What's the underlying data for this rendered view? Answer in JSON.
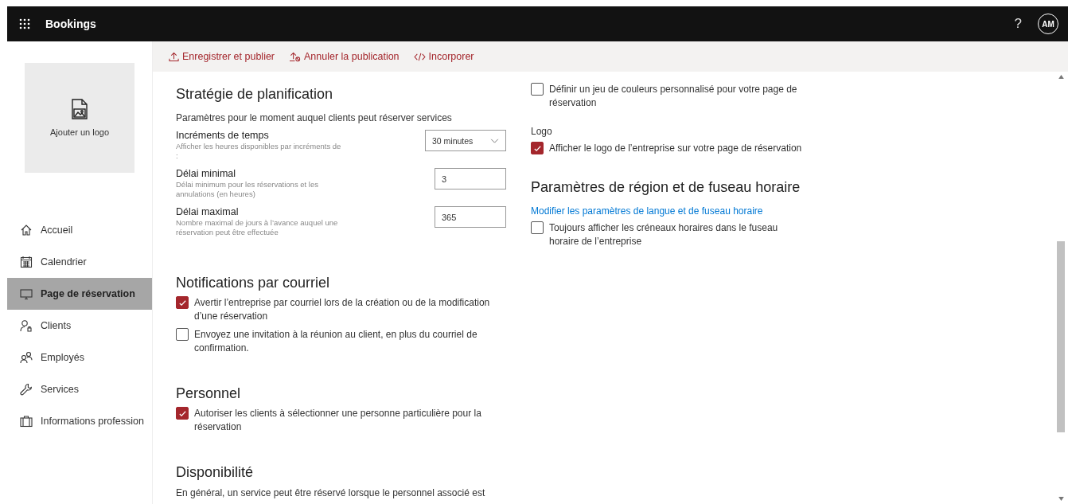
{
  "topbar": {
    "app_title": "Bookings",
    "help": "?",
    "avatar": "AM"
  },
  "toolbar": [
    {
      "label": "Enregistrer et publier"
    },
    {
      "label": "Annuler la publication"
    },
    {
      "label": "Incorporer"
    }
  ],
  "sidebar": {
    "logo_label": "Ajouter un logo",
    "items": [
      {
        "label": "Accueil",
        "selected": false
      },
      {
        "label": "Calendrier",
        "selected": false
      },
      {
        "label": "Page de réservation",
        "selected": true
      },
      {
        "label": "Clients",
        "selected": false
      },
      {
        "label": "Employés",
        "selected": false
      },
      {
        "label": "Services",
        "selected": false
      },
      {
        "label": "Informations profession",
        "selected": false
      }
    ]
  },
  "planning": {
    "title": "Stratégie de planification",
    "subtitle": "Paramètres pour le moment auquel clients peut réserver services",
    "settings": [
      {
        "kind": "select",
        "label": "Incréments de temps",
        "hint": "Afficher les heures disponibles par incréments de :",
        "value": "30 minutes"
      },
      {
        "kind": "text",
        "label": "Délai minimal",
        "hint": "Délai minimum pour les réservations et les annulations (en heures)",
        "value": "3"
      },
      {
        "kind": "text",
        "label": "Délai maximal",
        "hint": "Nombre maximal de jours à l’avance auquel une réservation peut être effectuée",
        "value": "365"
      }
    ]
  },
  "notifications": {
    "title": "Notifications par courriel",
    "options": [
      {
        "label": "Avertir l’entreprise par courriel lors de la création ou de la modification d’une réservation",
        "checked": true
      },
      {
        "label": "Envoyez une invitation à la réunion au client, en plus du courriel de confirmation.",
        "checked": false
      }
    ]
  },
  "personnel": {
    "title": "Personnel",
    "options": [
      {
        "label": "Autoriser les clients à sélectionner une personne particulière pour la réservation",
        "checked": true
      }
    ]
  },
  "availability": {
    "title": "Disponibilité",
    "text": "En général, un service peut être réservé lorsque le personnel associé est"
  },
  "colors": {
    "options": [
      {
        "label": "Définir un jeu de couleurs personnalisé pour votre page de réservation",
        "checked": false
      }
    ]
  },
  "logo": {
    "label": "Logo",
    "options": [
      {
        "label": "Afficher le logo de l’entreprise sur votre page de réservation",
        "checked": true
      }
    ]
  },
  "region": {
    "title": "Paramètres de région et de fuseau horaire",
    "link": "Modifier les paramètres de langue et de fuseau horaire",
    "options": [
      {
        "label": "Toujours afficher les créneaux horaires dans le fuseau horaire de l’entreprise",
        "checked": false
      }
    ]
  }
}
